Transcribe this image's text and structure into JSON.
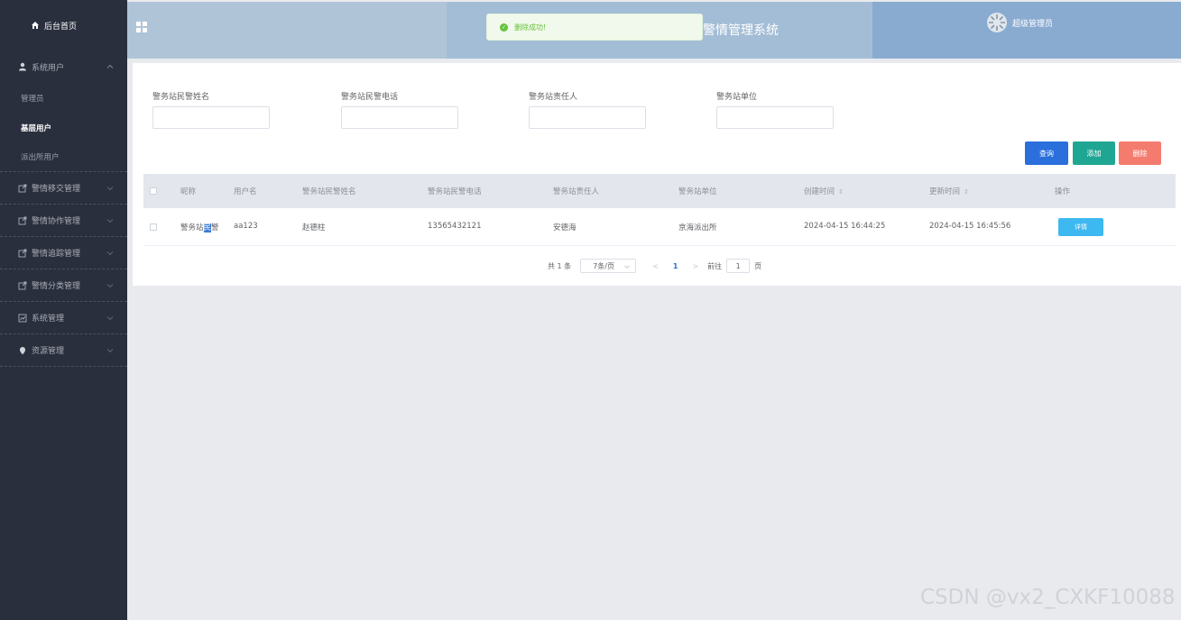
{
  "sidebar": {
    "home": "后台首页",
    "groups": [
      {
        "label": "系统用户",
        "icon": "user-icon",
        "expanded": true,
        "children": [
          "管理员",
          "基层用户",
          "派出所用户"
        ],
        "active": "基层用户"
      },
      {
        "label": "警情移交管理",
        "icon": "export-icon"
      },
      {
        "label": "警情协作管理",
        "icon": "export-icon"
      },
      {
        "label": "警情追踪管理",
        "icon": "export-icon"
      },
      {
        "label": "警情分类管理",
        "icon": "export-icon"
      },
      {
        "label": "系统管理",
        "icon": "chart-icon"
      },
      {
        "label": "资源管理",
        "icon": "pin-icon"
      }
    ]
  },
  "header": {
    "title": "警情管理系统",
    "user": "超级管理员",
    "toast": "删除成功!"
  },
  "search": {
    "fields": [
      {
        "label": "警务站民警姓名",
        "value": ""
      },
      {
        "label": "警务站民警电话",
        "value": ""
      },
      {
        "label": "警务站责任人",
        "value": ""
      },
      {
        "label": "警务站单位",
        "value": ""
      }
    ],
    "query_label": "查询",
    "add_label": "添加",
    "delete_label": "删除"
  },
  "table": {
    "columns": [
      "昵称",
      "用户名",
      "警务站民警姓名",
      "警务站民警电话",
      "警务站责任人",
      "警务站单位",
      "创建时间",
      "更新时间",
      "操作"
    ],
    "rows": [
      {
        "nickname_pre": "警务站",
        "nickname_hl": "民",
        "nickname_post": "警",
        "username": "aa123",
        "name": "赵德柱",
        "phone": "13565432121",
        "owner": "安德海",
        "unit": "京海派出所",
        "created": "2024-04-15 16:44:25",
        "updated": "2024-04-15 16:45:56",
        "action": "详情"
      }
    ]
  },
  "pagination": {
    "total": "共 1 条",
    "page_size": "7条/页",
    "prev": "<",
    "current": "1",
    "next": ">",
    "goto_label": "前往",
    "goto_value": "1",
    "page_suffix": "页"
  },
  "watermark": "CSDN @vx2_CXKF10088",
  "colors": {
    "sidebar": "#2a2f3e",
    "primary": "#2a6fdb",
    "success": "#1fa693",
    "danger": "#f47c6f",
    "detail": "#3db8f0"
  }
}
